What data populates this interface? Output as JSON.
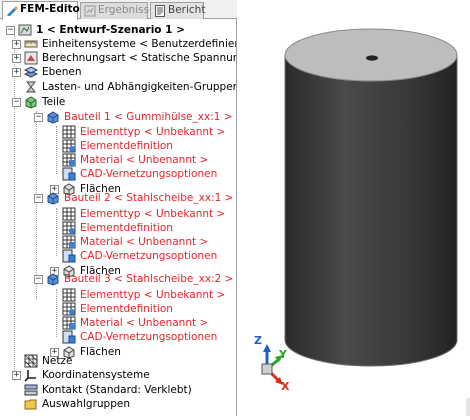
{
  "tabs": [
    {
      "label": "FEM-Editor",
      "state": "active",
      "icon": "fem-editor-icon"
    },
    {
      "label": "Ergebnisse",
      "state": "disabled",
      "icon": "results-icon"
    },
    {
      "label": "Bericht",
      "state": "normal",
      "icon": "report-icon"
    }
  ],
  "tree": {
    "root": "1 < Entwurf-Szenario 1 >",
    "einheitensysteme": "Einheitensysteme < Benutzerdefiniert >",
    "berechnungsart": "Berechnungsart < Statische Spannung mit lin",
    "ebenen": "Ebenen",
    "lasten": "Lasten- und Abhängigkeiten-Gruppen",
    "teile": "Teile",
    "parts": [
      {
        "label": "Bauteil 1 < Gummihülse_xx:1 >",
        "elementtyp": "Elementtyp < Unbekannt >",
        "elementdefinition": "Elementdefinition",
        "material": "Material < Unbenannt >",
        "cad": "CAD-Vernetzungsoptionen",
        "flaechen": "Flächen"
      },
      {
        "label": "Bauteil 2 < Stahlscheibe_xx:1 >",
        "elementtyp": "Elementtyp < Unbekannt >",
        "elementdefinition": "Elementdefinition",
        "material": "Material < Unbenannt >",
        "cad": "CAD-Vernetzungsoptionen",
        "flaechen": "Flächen"
      },
      {
        "label": "Bauteil 3 < Stahlscheibe_xx:2 >",
        "elementtyp": "Elementtyp < Unbekannt >",
        "elementdefinition": "Elementdefinition",
        "material": "Material < Unbenannt >",
        "cad": "CAD-Vernetzungsoptionen",
        "flaechen": "Flächen"
      }
    ],
    "netze": "Netze",
    "koordinatensysteme": "Koordinatensysteme",
    "kontakt": "Kontakt (Standard: Verklebt)",
    "auswahlgruppen": "Auswahlgruppen"
  },
  "triad": {
    "x": "X",
    "y": "Y",
    "z": "Z"
  },
  "colors": {
    "error_text": "#e8232a",
    "cylinder_side": "#3a3a3a",
    "cylinder_top": "#bdbdbd",
    "axis_x": "#d9301c",
    "axis_y": "#2aa52a",
    "axis_z": "#1e5fcf"
  }
}
